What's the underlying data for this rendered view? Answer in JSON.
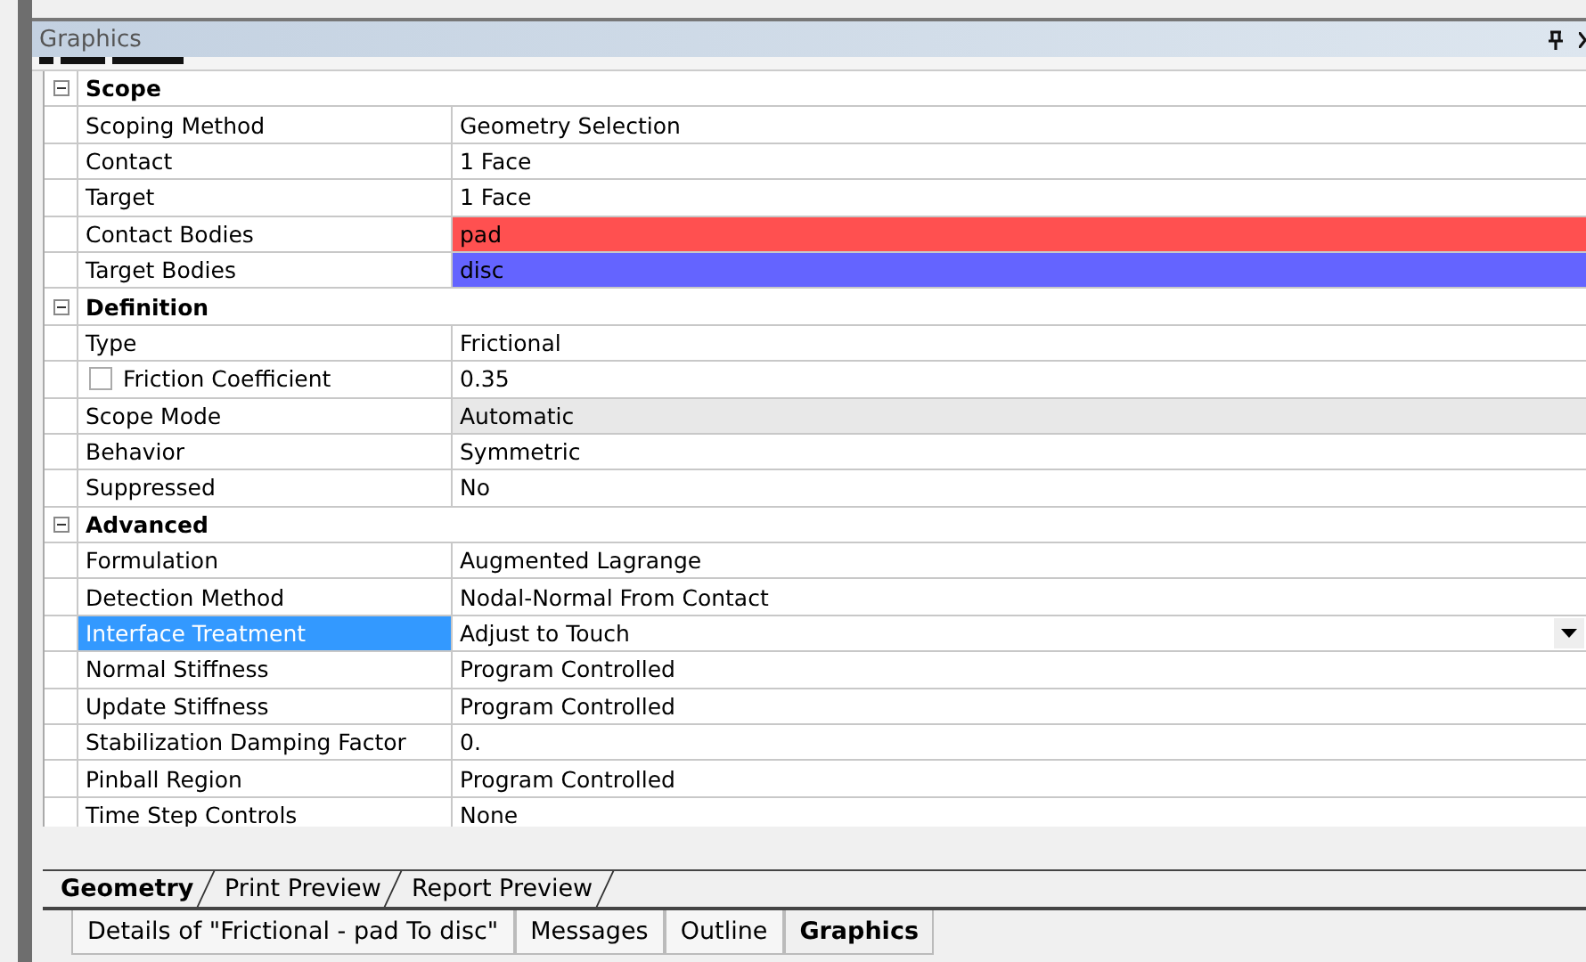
{
  "panel": {
    "title": "Graphics"
  },
  "groups": [
    {
      "title": "Scope",
      "expanded": true,
      "rows": [
        {
          "name": "Scoping Method",
          "value": "Geometry Selection",
          "kind": "text",
          "selected": false
        },
        {
          "name": "Contact",
          "value": "1 Face",
          "kind": "text",
          "selected": false
        },
        {
          "name": "Target",
          "value": "1 Face",
          "kind": "text",
          "selected": false
        },
        {
          "name": "Contact Bodies",
          "value": "pad",
          "kind": "color",
          "color": "#ff5050",
          "selected": false
        },
        {
          "name": "Target Bodies",
          "value": "disc",
          "kind": "color",
          "color": "#6464ff",
          "selected": false
        }
      ]
    },
    {
      "title": "Definition",
      "expanded": true,
      "rows": [
        {
          "name": "Type",
          "value": "Frictional",
          "kind": "text",
          "selected": false
        },
        {
          "name": "Friction Coefficient",
          "value": "0.35",
          "kind": "check",
          "checked": false,
          "selected": false
        },
        {
          "name": "Scope Mode",
          "value": "Automatic",
          "kind": "readonly",
          "selected": false
        },
        {
          "name": "Behavior",
          "value": "Symmetric",
          "kind": "text",
          "selected": false
        },
        {
          "name": "Suppressed",
          "value": "No",
          "kind": "text",
          "selected": false
        }
      ]
    },
    {
      "title": "Advanced",
      "expanded": true,
      "rows": [
        {
          "name": "Formulation",
          "value": "Augmented Lagrange",
          "kind": "text",
          "selected": false
        },
        {
          "name": "Detection Method",
          "value": "Nodal-Normal From Contact",
          "kind": "text",
          "selected": false
        },
        {
          "name": "Interface Treatment",
          "value": "Adjust to Touch",
          "kind": "dropdown",
          "selected": true
        },
        {
          "name": "Normal Stiffness",
          "value": "Program Controlled",
          "kind": "text",
          "selected": false
        },
        {
          "name": "Update Stiffness",
          "value": "Program Controlled",
          "kind": "text",
          "selected": false
        },
        {
          "name": "Stabilization Damping Factor",
          "value": "0.",
          "kind": "text",
          "selected": false
        },
        {
          "name": "Pinball Region",
          "value": "Program Controlled",
          "kind": "text",
          "selected": false
        },
        {
          "name": "Time Step Controls",
          "value": "None",
          "kind": "text",
          "selected": false
        }
      ]
    }
  ],
  "view_tabs": [
    {
      "label": "Geometry",
      "selected": true
    },
    {
      "label": "Print Preview",
      "selected": false
    },
    {
      "label": "Report Preview",
      "selected": false
    }
  ],
  "panel_tabs": [
    {
      "label": "Details of \"Frictional - pad To disc\"",
      "selected": false
    },
    {
      "label": "Messages",
      "selected": false
    },
    {
      "label": "Outline",
      "selected": false
    },
    {
      "label": "Graphics",
      "selected": true
    }
  ]
}
